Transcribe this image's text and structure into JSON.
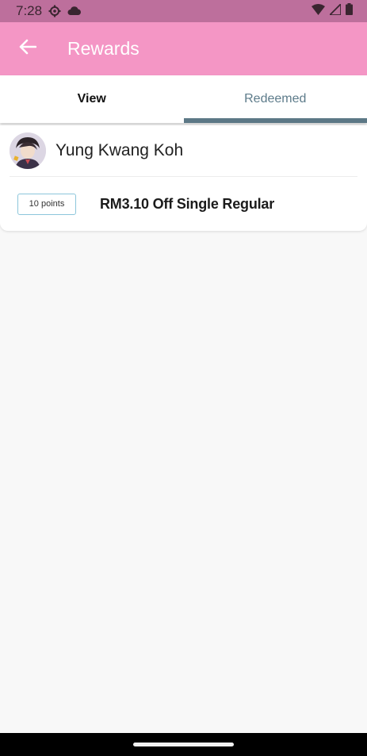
{
  "status_bar": {
    "time": "7:28",
    "icons": [
      "settings-icon",
      "cloud-icon",
      "wifi-icon",
      "signal-icon",
      "battery-icon"
    ]
  },
  "app_bar": {
    "title": "Rewards",
    "back_icon": "arrow-left-icon",
    "color": "#f496c5"
  },
  "tabs": [
    {
      "label": "View"
    },
    {
      "label": "Redeemed",
      "selected": true
    }
  ],
  "user": {
    "name": "Yung Kwang Koh"
  },
  "rewards": [
    {
      "points": "10 points",
      "title": "RM3.10 Off Single Regular"
    }
  ],
  "colors": {
    "status_bar": "#bd6f9c",
    "accent": "#5c7886",
    "badge_border": "#8cc6db"
  }
}
